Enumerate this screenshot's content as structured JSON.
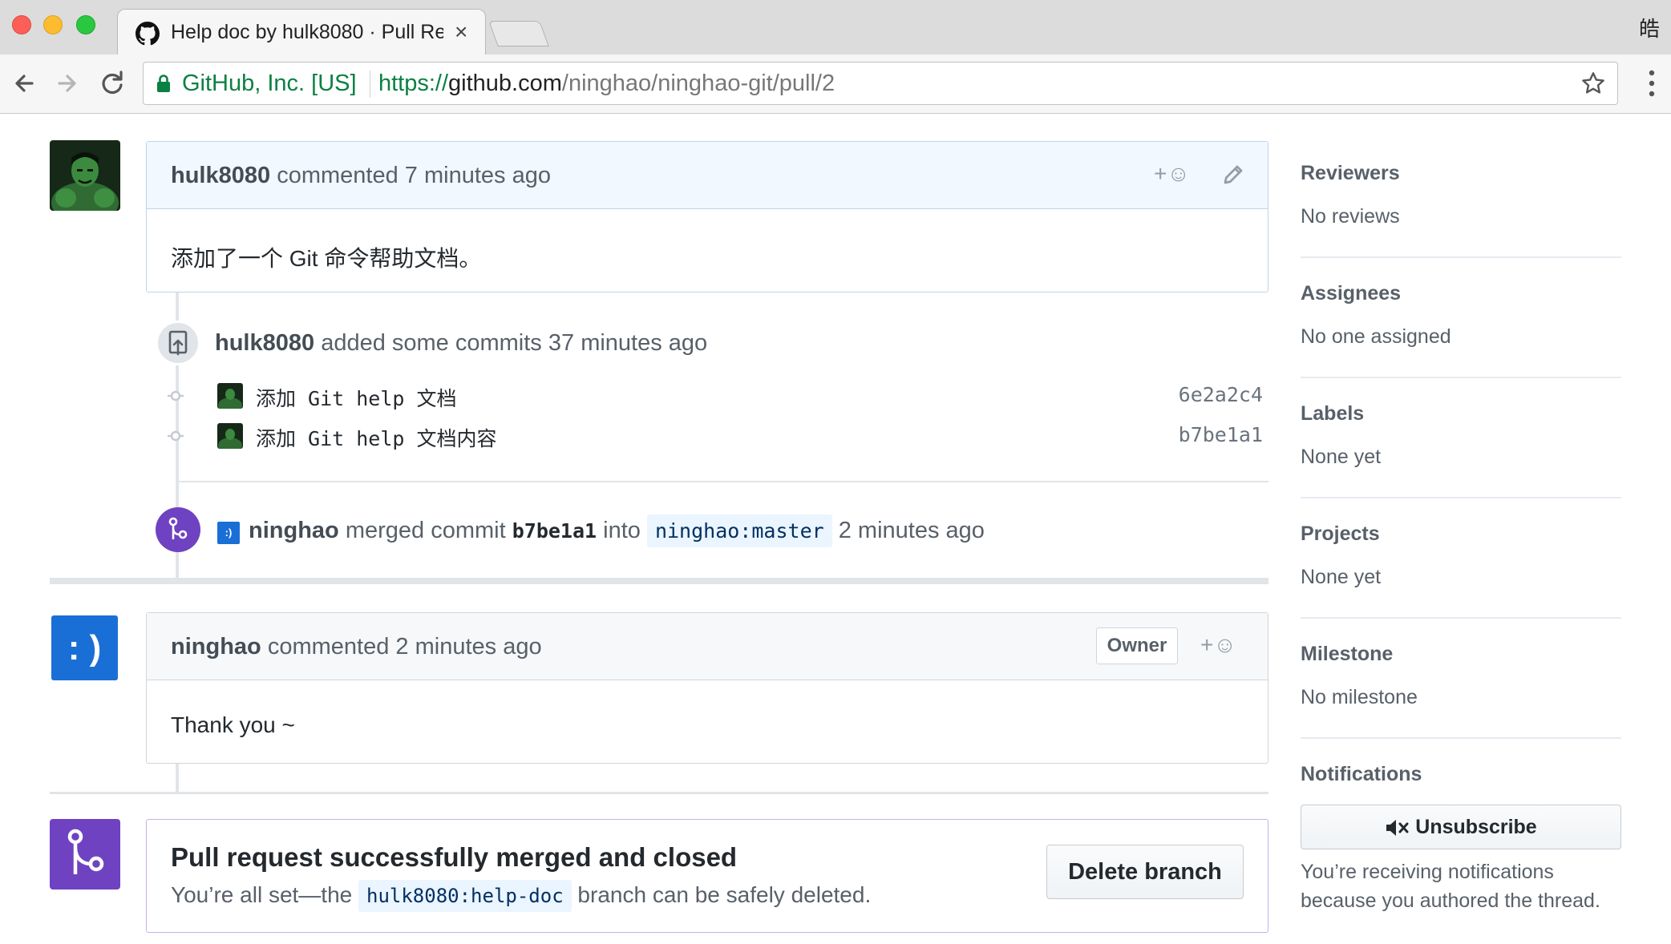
{
  "browser": {
    "tab_title_main": "Help doc by hulk8080 · Pull Re",
    "tab_title_fade": "",
    "tab_close": "×",
    "profile_glyph": "皓",
    "ev_org": "GitHub, Inc. [US]",
    "url_scheme": "https://",
    "url_host": "github.com",
    "url_path": "/ninghao/ninghao-git/pull/2"
  },
  "timeline": {
    "comment1": {
      "author": "hulk8080",
      "action": " commented ",
      "time": "7 minutes ago",
      "reaction": "+☺",
      "body": "添加了一个 Git 命令帮助文档。"
    },
    "push": {
      "author": "hulk8080",
      "action": " added some commits ",
      "time": "37 minutes ago"
    },
    "commits": [
      {
        "message": "添加 Git help 文档",
        "sha": "6e2a2c4"
      },
      {
        "message": "添加 Git help 文档内容",
        "sha": "b7be1a1"
      }
    ],
    "merge_event": {
      "avatar_text": ":)",
      "author": "ninghao",
      "action": " merged commit ",
      "sha": "b7be1a1",
      "into": " into ",
      "target_branch": "ninghao:master",
      "time": "2 minutes ago"
    },
    "comment2": {
      "avatar_text": ": )",
      "author": "ninghao",
      "action": " commented ",
      "time": "2 minutes ago",
      "badge": "Owner",
      "reaction": "+☺",
      "body": "Thank you ~"
    },
    "merge_status": {
      "title": "Pull request successfully merged and closed",
      "sub_before": "You’re all set—the ",
      "branch": "hulk8080:help-doc",
      "sub_after": " branch can be safely deleted.",
      "delete_button": "Delete branch"
    }
  },
  "sidebar": {
    "reviewers_title": "Reviewers",
    "reviewers_value": "No reviews",
    "assignees_title": "Assignees",
    "assignees_value": "No one assigned",
    "labels_title": "Labels",
    "labels_value": "None yet",
    "projects_title": "Projects",
    "projects_value": "None yet",
    "milestone_title": "Milestone",
    "milestone_value": "No milestone",
    "notifications_title": "Notifications",
    "unsubscribe_button": "Unsubscribe",
    "notification_reason": "You’re receiving notifications because you authored the thread."
  },
  "colors": {
    "merged_purple": "#6f42c1",
    "link_blue": "#0366d6",
    "secure_green": "#0b8043"
  },
  "icons": [
    "github-favicon",
    "back-icon",
    "forward-icon",
    "reload-icon",
    "lock-icon",
    "star-icon",
    "menu-icon",
    "add-reaction-icon",
    "pencil-icon",
    "repo-push-icon",
    "commit-icon",
    "git-merge-icon",
    "mute-icon"
  ]
}
